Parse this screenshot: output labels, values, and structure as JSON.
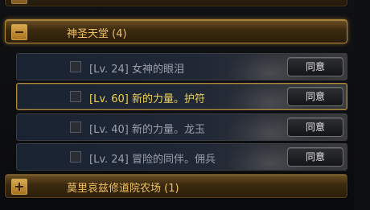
{
  "categories": [
    {
      "label": "",
      "toggle": "+",
      "state": "collapsed"
    },
    {
      "label": "神圣天堂 (4)",
      "toggle": "−",
      "state": "expanded"
    },
    {
      "label": "莫里哀兹修道院农场 (1)",
      "toggle": "+",
      "state": "collapsed"
    }
  ],
  "quests": [
    {
      "title": "[Lv. 24] 女神的眼泪",
      "button": "同意",
      "selected": false
    },
    {
      "title": "[Lv. 60] 新的力量。护符",
      "button": "同意",
      "selected": true
    },
    {
      "title": "[Lv. 40] 新的力量。龙玉",
      "button": "同意",
      "selected": false
    },
    {
      "title": "[Lv. 24] 冒险的同伴。佣兵",
      "button": "同意",
      "selected": false
    }
  ],
  "colors": {
    "category_text": "#f0c160",
    "selected_quest_text": "#ecd24e",
    "quest_text": "#9aa1ab",
    "highlight_border": "#b8892f"
  },
  "icons": {
    "expand": "plus-icon",
    "collapse": "minus-icon"
  }
}
